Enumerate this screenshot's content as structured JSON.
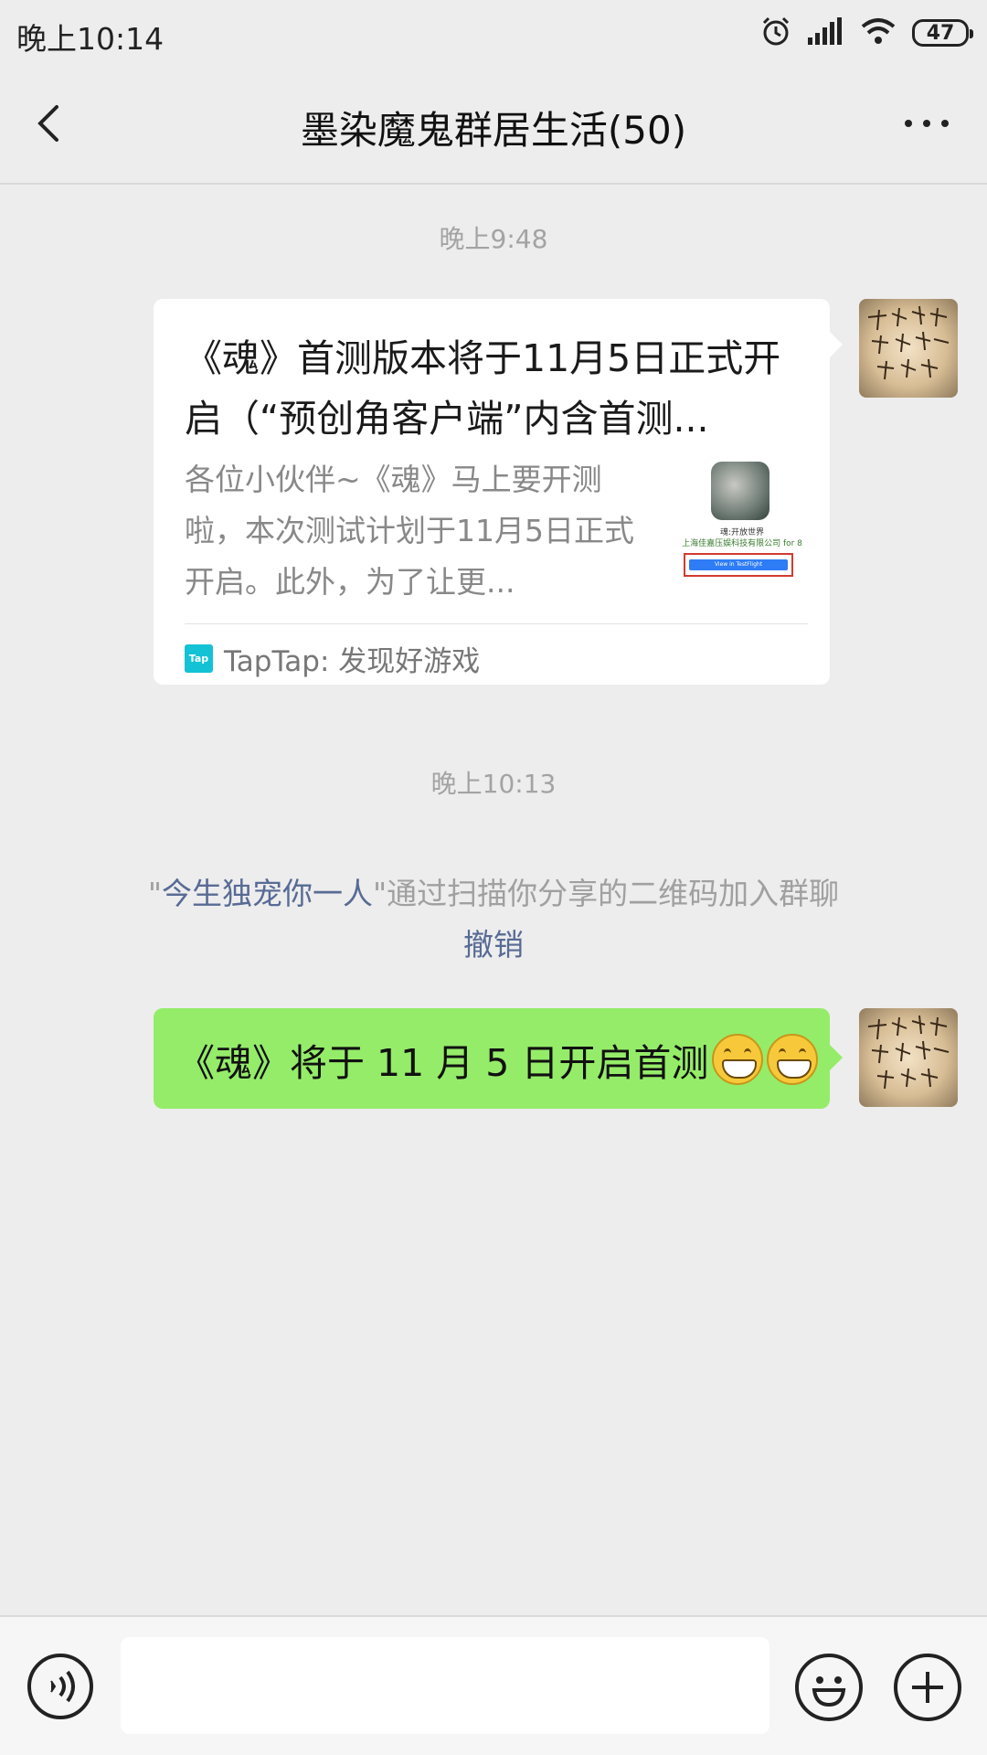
{
  "status_bar": {
    "time": "晚上10:14",
    "battery": "47",
    "icons": [
      "alarm-icon",
      "signal-icon",
      "wifi-icon",
      "battery-icon"
    ]
  },
  "header": {
    "title": "墨染魔鬼群居生活(50)",
    "back_icon": "chevron-left-icon",
    "more_icon": "more-dots-icon"
  },
  "messages": {
    "timestamp_1": "晚上9:48",
    "link_card": {
      "title": "《魂》首测版本将于11月5日正式开启（“预创角客户端”内含首测...",
      "description": "各位小伙伴~《魂》马上要开测啦，本次测试计划于11月5日正式开启。此外，为了让更...",
      "thumbnail_title": "魂:开放世界",
      "thumbnail_subtitle": "上海佳嘉压娱科技有限公司 for 8",
      "thumbnail_button": "View in TestFlight",
      "source_icon_text": "Tap",
      "source": "TapTap: 发现好游戏"
    },
    "timestamp_2": "晚上10:13",
    "system": {
      "quote_open": "\"",
      "name": "今生独宠你一人",
      "text": "\"通过扫描你分享的二维码加入群聊",
      "undo": "撤销"
    },
    "text_message": "《魂》将于 11 月 5 日开启首测"
  },
  "input_bar": {
    "voice_icon": "voice-icon",
    "emoji_icon": "emoji-icon",
    "plus_icon": "plus-icon",
    "input_value": ""
  },
  "colors": {
    "background": "#ededed",
    "bubble_green": "#95ec69",
    "link_blue": "#586b95",
    "taptap": "#13c2d4"
  }
}
